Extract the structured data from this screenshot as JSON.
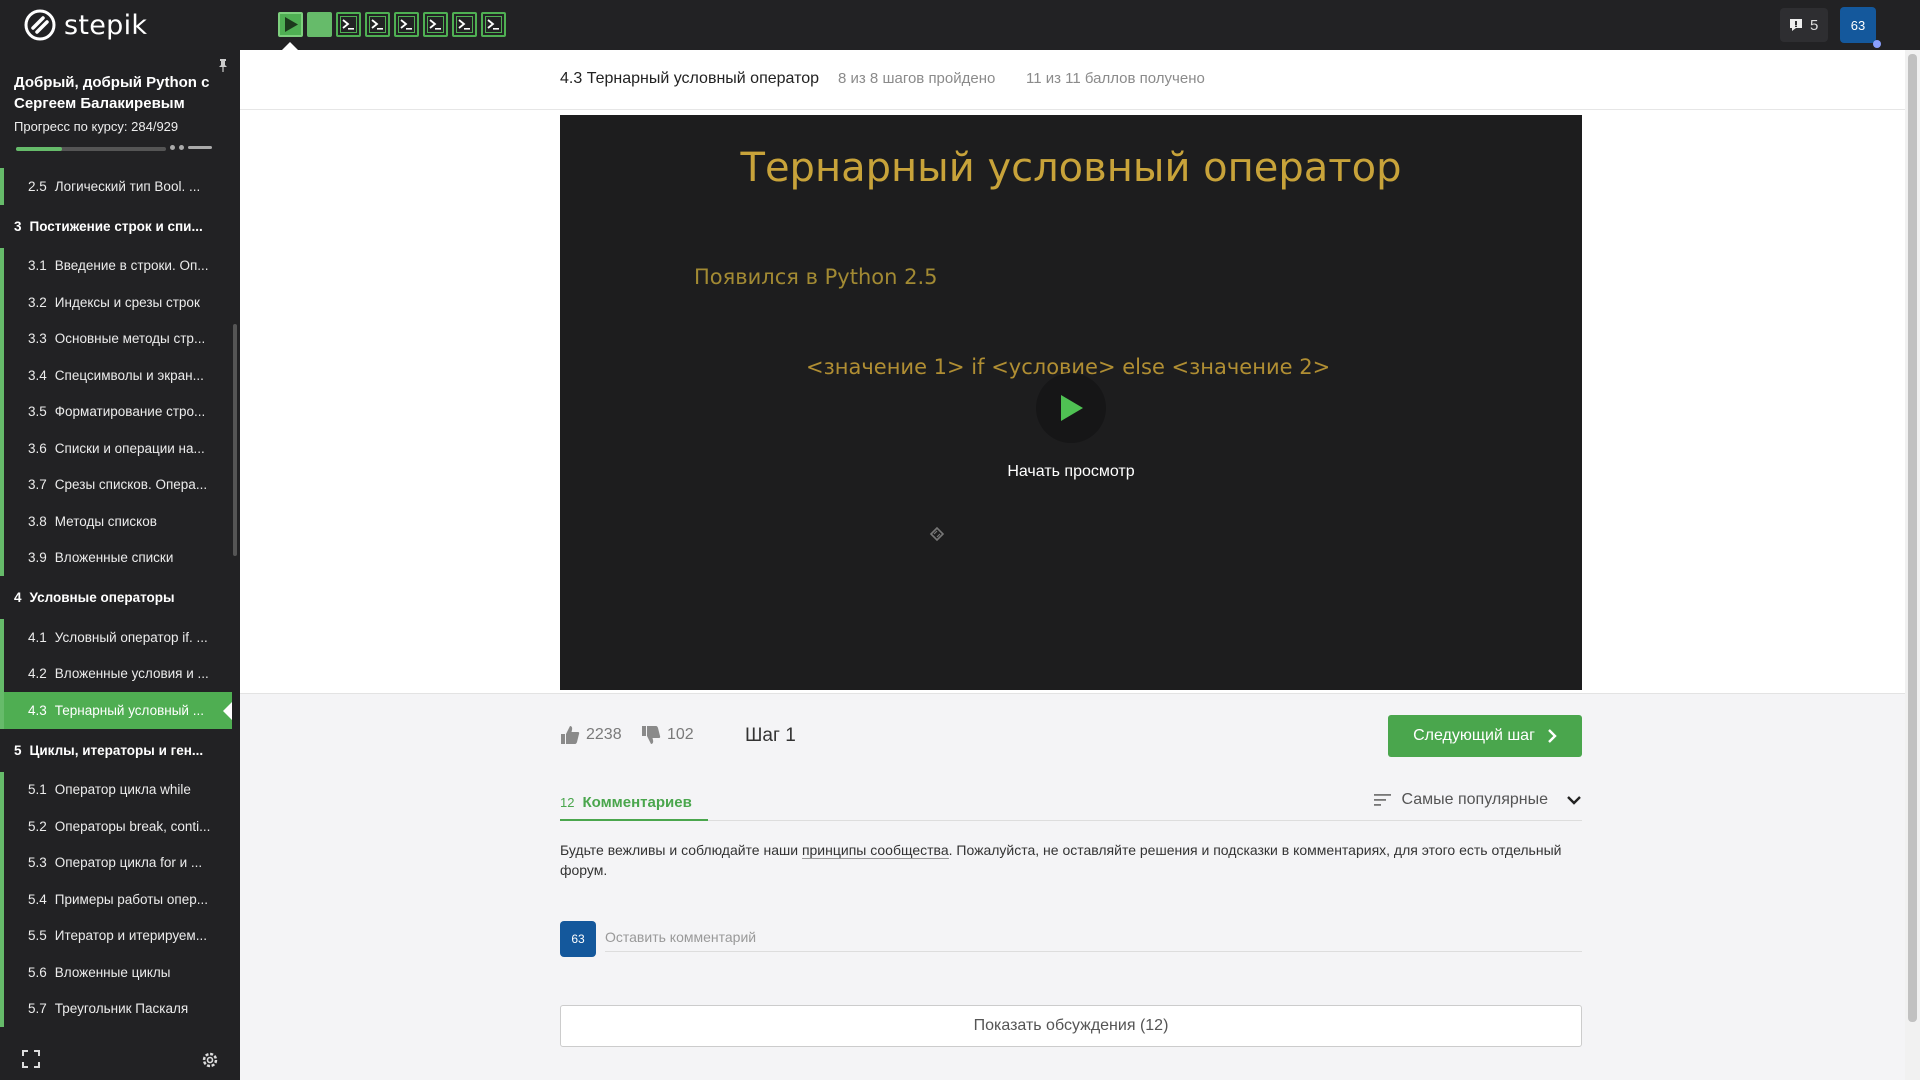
{
  "brand": {
    "name": "stepik"
  },
  "topbar": {
    "steps": [
      {
        "type": "video",
        "state": "current"
      },
      {
        "type": "text",
        "state": "filled"
      },
      {
        "type": "code",
        "state": "done"
      },
      {
        "type": "code",
        "state": "done"
      },
      {
        "type": "code",
        "state": "done"
      },
      {
        "type": "code",
        "state": "done"
      },
      {
        "type": "code",
        "state": "done"
      },
      {
        "type": "code",
        "state": "done"
      }
    ],
    "notifications_count": "5",
    "user_avatar_text": "63"
  },
  "sidebar": {
    "course_title": "Добрый, добрый Python с Сергеем Балакиревым",
    "progress_label": "Прогресс по курсу:  284/929",
    "progress_fraction": 0.3057,
    "items": [
      {
        "kind": "lesson",
        "num": "2.5",
        "label": "Логический тип Bool. ..."
      },
      {
        "kind": "section",
        "num": "3",
        "label": "Постижение строк и спи..."
      },
      {
        "kind": "lesson",
        "num": "3.1",
        "label": "Введение в строки. Оп..."
      },
      {
        "kind": "lesson",
        "num": "3.2",
        "label": "Индексы и срезы строк"
      },
      {
        "kind": "lesson",
        "num": "3.3",
        "label": "Основные методы стр..."
      },
      {
        "kind": "lesson",
        "num": "3.4",
        "label": "Спецсимволы и экран..."
      },
      {
        "kind": "lesson",
        "num": "3.5",
        "label": "Форматирование стро..."
      },
      {
        "kind": "lesson",
        "num": "3.6",
        "label": "Списки и операции на..."
      },
      {
        "kind": "lesson",
        "num": "3.7",
        "label": "Срезы списков. Опера..."
      },
      {
        "kind": "lesson",
        "num": "3.8",
        "label": "Методы списков"
      },
      {
        "kind": "lesson",
        "num": "3.9",
        "label": "Вложенные списки"
      },
      {
        "kind": "section",
        "num": "4",
        "label": "Условные операторы"
      },
      {
        "kind": "lesson",
        "num": "4.1",
        "label": "Условный оператор if. ..."
      },
      {
        "kind": "lesson",
        "num": "4.2",
        "label": "Вложенные условия и ..."
      },
      {
        "kind": "lesson",
        "num": "4.3",
        "label": "Тернарный условный ...",
        "active": true
      },
      {
        "kind": "section",
        "num": "5",
        "label": "Циклы, итераторы и ген..."
      },
      {
        "kind": "lesson",
        "num": "5.1",
        "label": "Оператор цикла while"
      },
      {
        "kind": "lesson",
        "num": "5.2",
        "label": "Операторы break, conti..."
      },
      {
        "kind": "lesson",
        "num": "5.3",
        "label": "Оператор цикла for и ..."
      },
      {
        "kind": "lesson",
        "num": "5.4",
        "label": "Примеры работы опер..."
      },
      {
        "kind": "lesson",
        "num": "5.5",
        "label": "Итератор и итерируем..."
      },
      {
        "kind": "lesson",
        "num": "5.6",
        "label": "Вложенные циклы"
      },
      {
        "kind": "lesson",
        "num": "5.7",
        "label": "Треугольник Паскаля"
      }
    ]
  },
  "lesson": {
    "title": "4.3 Тернарный условный оператор",
    "steps_passed": "8 из 8 шагов пройдено",
    "points": "11 из 11 баллов  получено"
  },
  "video": {
    "slide_title": "Тернарный условный оператор",
    "slide_subtitle": "Появился в Python 2.5",
    "slide_code": "<значение 1> if <условие> else <значение 2>",
    "watch_label": "Начать просмотр"
  },
  "footer": {
    "likes": "2238",
    "dislikes": "102",
    "step_label": "Шаг 1",
    "next_label": "Следующий шаг"
  },
  "comments": {
    "count": "12",
    "tab_label": "Комментариев",
    "sort_label": "Самые популярные",
    "rules_before": "Будьте вежливы и соблюдайте наши ",
    "rules_link": "принципы сообщества",
    "rules_after": ". Пожалуйста, не оставляйте решения и подсказки в комментариях, для этого есть отдельный форум.",
    "avatar_text": "63",
    "input_placeholder": "Оставить комментарий",
    "show_discussions": "Показать обсуждения (12)"
  },
  "colors": {
    "accent": "#4aa64d",
    "topbar_bg": "#222224",
    "avatar_bg": "#14589c"
  }
}
